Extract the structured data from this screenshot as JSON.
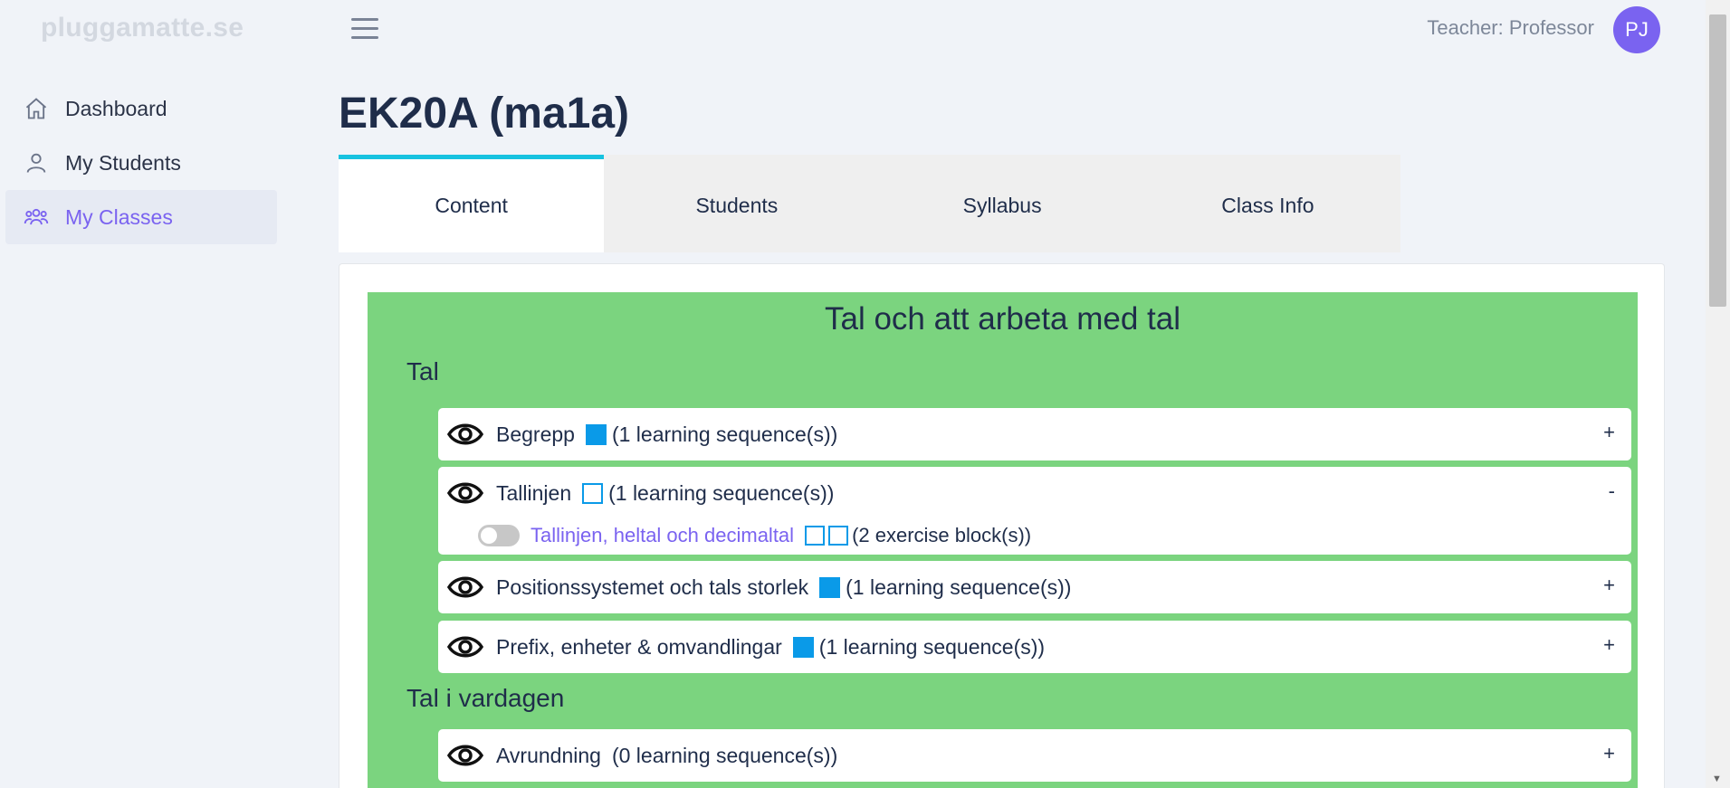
{
  "brand": "pluggamatte.se",
  "header": {
    "teacher_label": "Teacher: Professor",
    "avatar_initials": "PJ"
  },
  "sidebar": {
    "items": [
      {
        "label": "Dashboard",
        "icon": "home-icon",
        "active": false
      },
      {
        "label": "My Students",
        "icon": "user-icon",
        "active": false
      },
      {
        "label": "My Classes",
        "icon": "group-icon",
        "active": true
      }
    ]
  },
  "page_title": "EK20A (ma1a)",
  "tabs": [
    {
      "label": "Content",
      "active": true
    },
    {
      "label": "Students",
      "active": false
    },
    {
      "label": "Syllabus",
      "active": false
    },
    {
      "label": "Class Info",
      "active": false
    }
  ],
  "content": {
    "section_title": "Tal och att arbeta med tal",
    "groups": [
      {
        "title": "Tal",
        "topics": [
          {
            "name": "Begrepp",
            "marker": "filled",
            "count_text": "(1 learning sequence(s))",
            "toggle": "+"
          },
          {
            "name": "Tallinjen",
            "marker": "outline",
            "count_text": "(1 learning sequence(s))",
            "toggle": "-",
            "sequence": {
              "name": "Tallinjen, heltal och decimaltal",
              "count_text": "(2 exercise block(s))"
            }
          },
          {
            "name": "Positionssystemet och tals storlek",
            "marker": "filled",
            "count_text": "(1 learning sequence(s))",
            "toggle": "+"
          },
          {
            "name": "Prefix, enheter & omvandlingar",
            "marker": "filled",
            "count_text": "(1 learning sequence(s))",
            "toggle": "+"
          }
        ]
      },
      {
        "title": "Tal i vardagen",
        "topics": [
          {
            "name": "Avrundning",
            "marker": "none",
            "count_text": "(0 learning sequence(s))",
            "toggle": "+"
          }
        ]
      }
    ]
  },
  "colors": {
    "accent": "#7a63f0",
    "tab_indicator": "#17c2e0",
    "section_bg": "#7bd47f",
    "marker_blue": "#0a9ae8"
  }
}
